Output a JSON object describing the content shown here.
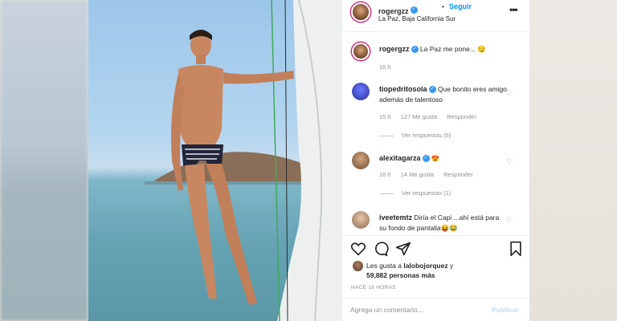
{
  "post": {
    "username": "rogergzz",
    "follow_label": "Seguir",
    "dot": "•",
    "location": "La Paz, Baja California Sur",
    "more": "•••"
  },
  "caption": {
    "username": "rogergzz",
    "text": "La Paz me pone... 😏",
    "time": "16 h"
  },
  "comments": [
    {
      "username": "tiopedritosola",
      "text": "Que bonito eres amigo además de talentoso",
      "time": "15 h",
      "likes": "127 Me gusta",
      "reply": "Responder",
      "replies": "Ver respuestas (6)"
    },
    {
      "username": "alexitagarza",
      "text": "😍",
      "time": "16 h",
      "likes": "14 Me gusta",
      "reply": "Responder",
      "replies": "Ver respuestas (1)"
    },
    {
      "username": "iveetemtz",
      "text": "Diría el Capi ...ahí está para su fondo de pantalla😝😂"
    }
  ],
  "actions": {
    "like_icon": "heart-icon",
    "comment_icon": "comment-icon",
    "share_icon": "share-icon",
    "save_icon": "bookmark-icon"
  },
  "likes": {
    "prefix": "Les gusta a",
    "user": "lalobojorquez",
    "conj": "y",
    "count": "59,882 personas más"
  },
  "timeago": "HACE 16 HORAS",
  "compose": {
    "placeholder": "Agrega un comentario...",
    "publish": "Publicar"
  },
  "colors": {
    "accent": "#0095f6",
    "verified": "#3897f0",
    "publish_disabled": "#b2dffc"
  }
}
